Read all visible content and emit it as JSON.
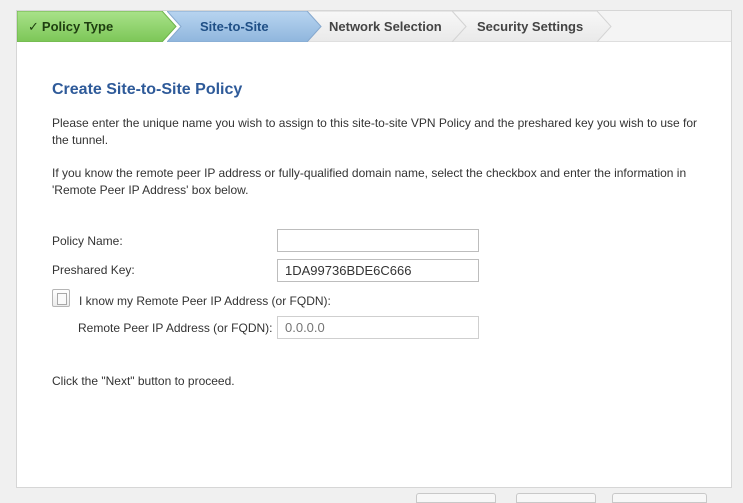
{
  "wizard": {
    "steps": [
      {
        "label": "Policy Type",
        "state": "completed",
        "check": "✓"
      },
      {
        "label": "Site-to-Site",
        "state": "active"
      },
      {
        "label": "Network Selection",
        "state": "pending"
      },
      {
        "label": "Security Settings",
        "state": "pending"
      }
    ]
  },
  "page": {
    "title": "Create Site-to-Site Policy",
    "intro": "Please enter the unique name you wish to assign to this site-to-site VPN Policy and the preshared key you wish to use for the tunnel.",
    "remote_hint": "If you know the remote peer IP address or fully-qualified domain name, select the checkbox and enter the information in 'Remote Peer IP Address' box below.",
    "footer_hint": "Click the \"Next\" button to proceed."
  },
  "form": {
    "policy_name_label": "Policy Name:",
    "policy_name_value": "",
    "preshared_key_label": "Preshared Key:",
    "preshared_key_value": "1DA99736BDE6C666",
    "remote_checkbox_label": "I know my Remote Peer IP Address (or FQDN):",
    "remote_checkbox_checked": false,
    "remote_peer_label": "Remote Peer IP Address (or FQDN):",
    "remote_peer_placeholder": "0.0.0.0"
  },
  "colors": {
    "completed_step": "#8fd26b",
    "active_step": "#9ec2e6",
    "pending_step": "#eeeeee",
    "title": "#2e5a99"
  }
}
